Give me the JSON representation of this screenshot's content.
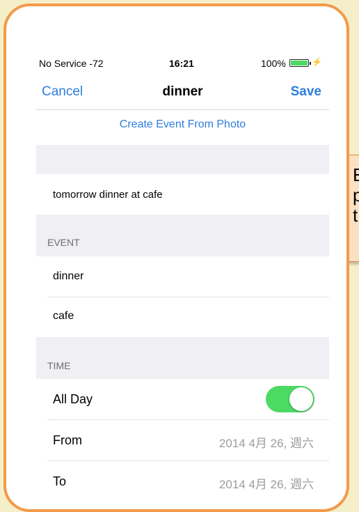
{
  "callout": {
    "text": "E\np\nt"
  },
  "status_bar": {
    "carrier": "No Service -72",
    "time": "16:21",
    "battery": "100%"
  },
  "nav": {
    "cancel": "Cancel",
    "title": "dinner",
    "save": "Save"
  },
  "create_link": "Create Event From Photo",
  "input_text": "tomorrow  dinner at cafe",
  "event_section": {
    "header": "EVENT",
    "title": "dinner",
    "location": "cafe"
  },
  "time_section": {
    "header": "TIME",
    "all_day_label": "All Day",
    "all_day": true,
    "from_label": "From",
    "from_value": "2014 4月 26, 週六",
    "to_label": "To",
    "to_value": "2014 4月 26, 週六"
  },
  "colors": {
    "background": "#f5efc9",
    "card_border": "#f29a4a",
    "accent_blue": "#2e7ddd",
    "toggle_on": "#4cd964",
    "section_bg": "#efeff4"
  }
}
